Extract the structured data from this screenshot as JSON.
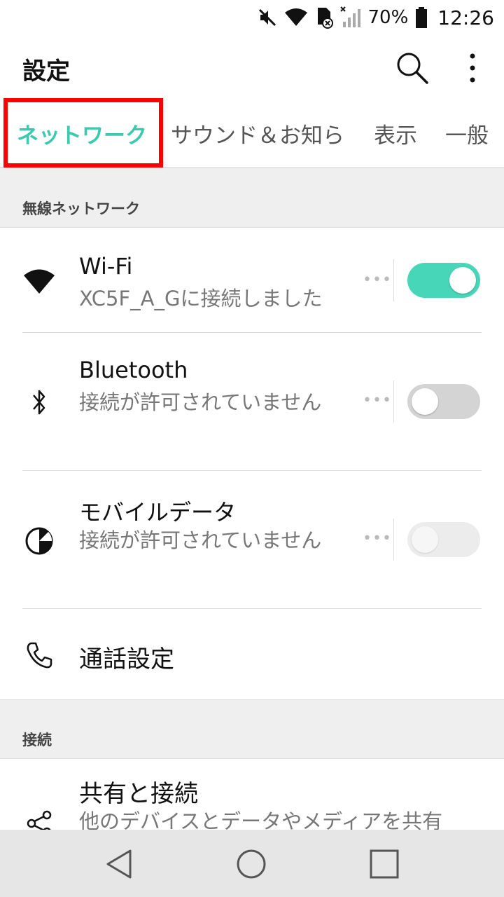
{
  "status": {
    "battery": "70%",
    "time": "12:26"
  },
  "app": {
    "title": "設定"
  },
  "tabs": [
    {
      "label": "ネットワーク",
      "active": true
    },
    {
      "label": "サウンド＆お知ら",
      "active": false
    },
    {
      "label": "表示",
      "active": false
    },
    {
      "label": "一般",
      "active": false
    }
  ],
  "sections": {
    "wireless": {
      "label": "無線ネットワーク"
    },
    "connect": {
      "label": "接続"
    }
  },
  "items": {
    "wifi": {
      "title": "Wi-Fi",
      "subtitle": "XC5F_A_Gに接続しました",
      "toggle": "on"
    },
    "bluetooth": {
      "title": "Bluetooth",
      "subtitle": "接続が許可されていません",
      "toggle": "off"
    },
    "mobile_data": {
      "title": "モバイルデータ",
      "subtitle": "接続が許可されていません",
      "toggle": "disabled"
    },
    "call": {
      "title": "通話設定"
    },
    "share": {
      "title": "共有と接続",
      "subtitle": "他のデバイスとデータやメディアを共有"
    }
  },
  "dots": "•••",
  "colors": {
    "accent": "#3dc9b0",
    "toggle_on": "#48d6b8",
    "highlight": "#ff0000"
  },
  "icons": {
    "mute": "mute-icon",
    "wifi": "wifi-icon",
    "sim": "sim-icon",
    "signal": "signal-icon",
    "battery": "battery-icon",
    "search": "search-icon",
    "more": "more-vert-icon",
    "bluetooth": "bluetooth-icon",
    "mobile_data": "mobile-data-icon",
    "phone": "phone-icon",
    "share": "share-icon",
    "back": "back-icon",
    "home": "home-icon",
    "recents": "recents-icon"
  }
}
